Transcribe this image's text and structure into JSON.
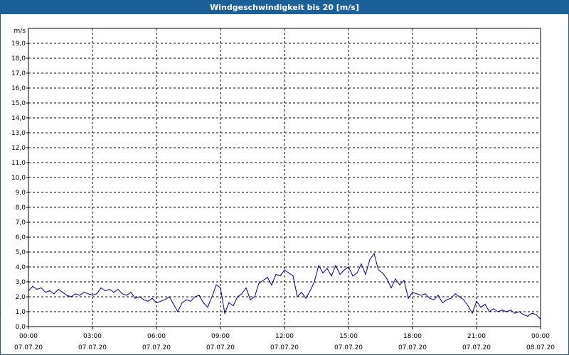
{
  "chart_data": {
    "type": "line",
    "title": "Windgeschwindigkeit bis 20 [m/s]",
    "ylabel": "m/s",
    "ylim": [
      0,
      20
    ],
    "yticks": [
      "0,0",
      "1,0",
      "2,0",
      "3,0",
      "4,0",
      "5,0",
      "6,0",
      "7,0",
      "8,0",
      "9,0",
      "10,0",
      "11,0",
      "12,0",
      "13,0",
      "14,0",
      "15,0",
      "16,0",
      "17,0",
      "18,0",
      "19,0"
    ],
    "xticks": [
      {
        "time": "00:00",
        "date": "07.07.20"
      },
      {
        "time": "03:00",
        "date": "07.07.20"
      },
      {
        "time": "06:00",
        "date": "07.07.20"
      },
      {
        "time": "09:00",
        "date": "07.07.20"
      },
      {
        "time": "12:00",
        "date": "07.07.20"
      },
      {
        "time": "15:00",
        "date": "07.07.20"
      },
      {
        "time": "18:00",
        "date": "07.07.20"
      },
      {
        "time": "21:00",
        "date": "07.07.20"
      },
      {
        "time": "00:00",
        "date": "08.07.20"
      }
    ],
    "grid": true,
    "line_color": "#00008b",
    "series": [
      {
        "x_hours": [
          0,
          0.2,
          0.4,
          0.6,
          0.8,
          1.0,
          1.2,
          1.4,
          1.6,
          1.8,
          2.0,
          2.2,
          2.4,
          2.6,
          2.8,
          3.0,
          3.2,
          3.4,
          3.6,
          3.8,
          4.0,
          4.2,
          4.4,
          4.6,
          4.8,
          5.0,
          5.2,
          5.4,
          5.6,
          5.8,
          6.0,
          6.2,
          6.4,
          6.6,
          6.8,
          7.0,
          7.2,
          7.4,
          7.6,
          7.8,
          8.0,
          8.2,
          8.4,
          8.6,
          8.8,
          9.0,
          9.2,
          9.4,
          9.6,
          9.8,
          10.0,
          10.2,
          10.4,
          10.6,
          10.8,
          11.0,
          11.2,
          11.4,
          11.6,
          11.8,
          12.0,
          12.2,
          12.4,
          12.6,
          12.8,
          13.0,
          13.2,
          13.4,
          13.6,
          13.8,
          14.0,
          14.2,
          14.4,
          14.6,
          14.8,
          15.0,
          15.2,
          15.4,
          15.6,
          15.8,
          16.0,
          16.2,
          16.4,
          16.6,
          16.8,
          17.0,
          17.2,
          17.4,
          17.6,
          17.8,
          18.0,
          18.2,
          18.4,
          18.6,
          18.8,
          19.0,
          19.2,
          19.4,
          19.6,
          19.8,
          20.0,
          20.2,
          20.4,
          20.6,
          20.8,
          21.0,
          21.2,
          21.4,
          21.6,
          21.8,
          22.0,
          22.2,
          22.4,
          22.6,
          22.8,
          23.0,
          23.2,
          23.4,
          23.6,
          23.8,
          24.0
        ],
        "values": [
          2.4,
          2.7,
          2.5,
          2.6,
          2.3,
          2.4,
          2.2,
          2.5,
          2.3,
          2.1,
          2.0,
          2.2,
          2.1,
          2.3,
          2.2,
          2.1,
          2.2,
          2.6,
          2.4,
          2.5,
          2.3,
          2.5,
          2.2,
          2.1,
          2.3,
          1.9,
          2.0,
          1.8,
          1.7,
          1.9,
          1.6,
          1.7,
          1.8,
          2.0,
          1.5,
          1.0,
          1.6,
          1.8,
          1.7,
          2.0,
          2.1,
          1.6,
          1.3,
          2.0,
          2.8,
          2.6,
          0.9,
          1.6,
          1.4,
          2.0,
          2.2,
          2.6,
          1.8,
          2.0,
          2.9,
          3.1,
          3.3,
          2.8,
          3.5,
          3.4,
          3.8,
          3.6,
          3.4,
          2.0,
          2.3,
          1.9,
          2.4,
          3.0,
          4.1,
          3.6,
          3.9,
          3.4,
          4.1,
          3.5,
          3.8,
          4.0,
          3.4,
          3.6,
          4.2,
          3.5,
          4.5,
          4.9,
          3.8,
          3.6,
          3.2,
          2.6,
          3.2,
          2.8,
          3.1,
          1.9,
          2.3,
          2.2,
          2.1,
          2.2,
          1.9,
          1.8,
          2.1,
          1.6,
          1.8,
          1.9,
          2.2,
          2.0,
          1.8,
          1.4,
          0.9,
          1.7,
          1.3,
          1.5,
          1.0,
          1.2,
          1.0,
          1.1,
          1.0,
          1.1,
          0.9,
          1.0,
          0.8,
          0.7,
          0.9,
          0.8,
          0.5,
          0.9,
          0.8,
          1.0,
          0.9
        ]
      }
    ]
  }
}
